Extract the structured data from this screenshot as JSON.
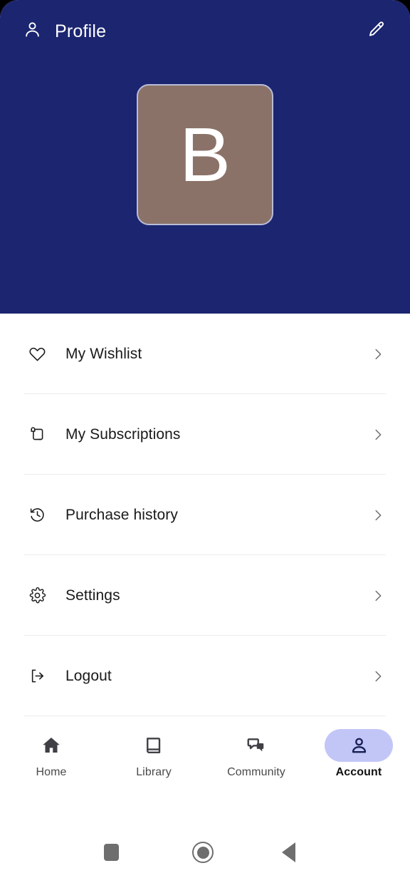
{
  "header": {
    "title": "Profile",
    "profile_icon": "person-icon",
    "edit_icon": "pencil-edit-icon",
    "background_color": "#1b2570"
  },
  "avatar": {
    "initial": "B",
    "background_color": "#8b7268",
    "border_color": "#b9bcd8",
    "text_color": "#ffffff"
  },
  "menu": {
    "items": [
      {
        "label": "My Wishlist",
        "icon": "heart-icon",
        "chevron": "chevron-right-icon"
      },
      {
        "label": "My Subscriptions",
        "icon": "scroll-icon",
        "chevron": "chevron-right-icon"
      },
      {
        "label": "Purchase history",
        "icon": "clock-history-icon",
        "chevron": "chevron-right-icon"
      },
      {
        "label": "Settings",
        "icon": "gear-icon",
        "chevron": "chevron-right-icon"
      },
      {
        "label": "Logout",
        "icon": "logout-icon",
        "chevron": "chevron-right-icon"
      }
    ]
  },
  "bottom_nav": {
    "active_color": "#c2c6f7",
    "items": [
      {
        "label": "Home",
        "icon": "home-icon",
        "active": false
      },
      {
        "label": "Library",
        "icon": "book-icon",
        "active": false
      },
      {
        "label": "Community",
        "icon": "chat-bubbles-icon",
        "active": false
      },
      {
        "label": "Account",
        "icon": "person-icon",
        "active": true
      }
    ]
  },
  "system_bar": {
    "recents_icon": "square-recents-icon",
    "home_icon": "circle-home-icon",
    "back_icon": "triangle-back-icon",
    "color": "#6e6e6e"
  }
}
